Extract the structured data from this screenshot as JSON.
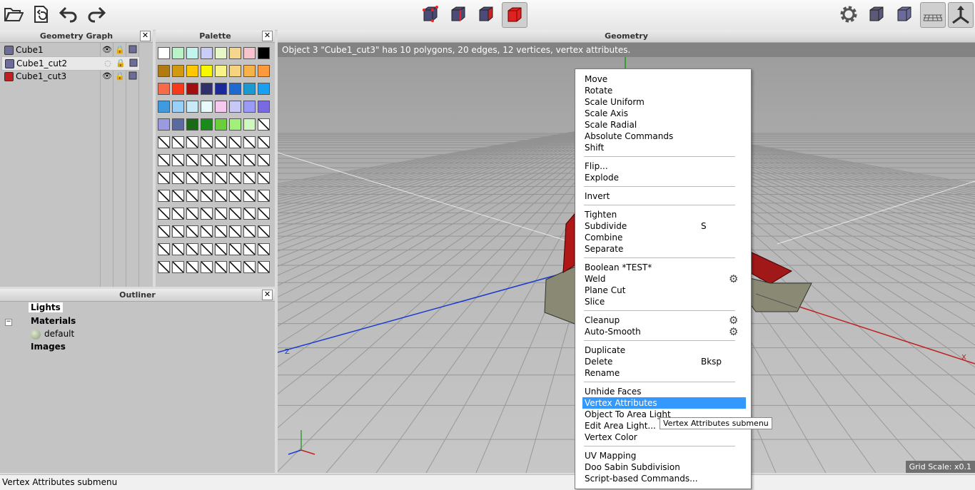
{
  "toolbar": {
    "left_icons": [
      "open-folder-icon",
      "import-icon",
      "undo-icon",
      "redo-icon"
    ],
    "mode_icons": [
      "vertex-mode-icon",
      "edge-mode-icon",
      "face-mode-icon",
      "object-mode-icon"
    ],
    "right_icons": [
      "settings-gear-icon",
      "smooth-shaded-cube-icon",
      "shaded-cube-icon",
      "grid-plane-icon",
      "axes-icon"
    ]
  },
  "geometry_graph": {
    "title": "Geometry Graph",
    "items": [
      {
        "label": "Cube1",
        "color": "#6d6d9a"
      },
      {
        "label": "Cube1_cut2",
        "color": "#6d6d9a"
      },
      {
        "label": "Cube1_cut3",
        "color": "#c22020"
      }
    ]
  },
  "palette": {
    "title": "Palette",
    "colors": [
      "#ffffff",
      "#b9f4c8",
      "#c3f5ef",
      "#c9cdf7",
      "#e6f7c8",
      "#f6d58c",
      "#f7c3cc",
      "#000000",
      "#b27a10",
      "#d29a10",
      "#ffc800",
      "#f7f700",
      "#f7f28a",
      "#f7d27f",
      "#f7b24a",
      "#ff9a3c",
      "#f76a4a",
      "#f73a1a",
      "#a01010",
      "#30306a",
      "#1a2a9a",
      "#1f6ad0",
      "#1a9ad0",
      "#1aa0f0",
      "#3f9ae0",
      "#9ad0f7",
      "#c8eaf7",
      "#e8fafa",
      "#f7c8f0",
      "#c8c8f7",
      "#9a9af7",
      "#7a6ae0",
      "#9a9ae0",
      "#5a6aa0",
      "#1a6a1a",
      "#1a8a1a",
      "#6ad03a",
      "#a0f07a",
      "#d0f7c0",
      ""
    ]
  },
  "outliner": {
    "title": "Outliner",
    "items": [
      "Lights",
      "Materials",
      "default",
      "Images"
    ]
  },
  "viewport": {
    "title": "Geometry",
    "info": "Object 3 \"Cube1_cut3\" has 10 polygons, 20 edges, 12 vertices, vertex attributes.",
    "grid_scale": "Grid Scale: x0.1",
    "axis_z": "Z",
    "axis_x": "X"
  },
  "context_menu": {
    "groups": [
      [
        {
          "label": "Move"
        },
        {
          "label": "Rotate"
        },
        {
          "label": "Scale Uniform"
        },
        {
          "label": "Scale Axis"
        },
        {
          "label": "Scale Radial"
        },
        {
          "label": "Absolute Commands"
        },
        {
          "label": "Shift"
        }
      ],
      [
        {
          "label": "Flip..."
        },
        {
          "label": "Explode"
        }
      ],
      [
        {
          "label": "Invert"
        }
      ],
      [
        {
          "label": "Tighten"
        },
        {
          "label": "Subdivide",
          "shortcut": "S"
        },
        {
          "label": "Combine"
        },
        {
          "label": "Separate"
        }
      ],
      [
        {
          "label": "Boolean *TEST*"
        },
        {
          "label": "Weld",
          "gear": true
        },
        {
          "label": "Plane Cut"
        },
        {
          "label": "Slice"
        }
      ],
      [
        {
          "label": "Cleanup",
          "gear": true
        },
        {
          "label": "Auto-Smooth",
          "gear": true
        }
      ],
      [
        {
          "label": "Duplicate"
        },
        {
          "label": "Delete",
          "shortcut": "Bksp"
        },
        {
          "label": "Rename"
        }
      ],
      [
        {
          "label": "Unhide Faces"
        },
        {
          "label": "Vertex Attributes",
          "highlight": true
        },
        {
          "label": "Object To Area Light"
        },
        {
          "label": "Edit Area Light..."
        },
        {
          "label": "Vertex Color"
        }
      ],
      [
        {
          "label": "UV Mapping"
        },
        {
          "label": "Doo Sabin Subdivision"
        },
        {
          "label": "Script-based Commands..."
        }
      ]
    ]
  },
  "tooltip": "Vertex Attributes submenu",
  "status": "Vertex Attributes submenu"
}
